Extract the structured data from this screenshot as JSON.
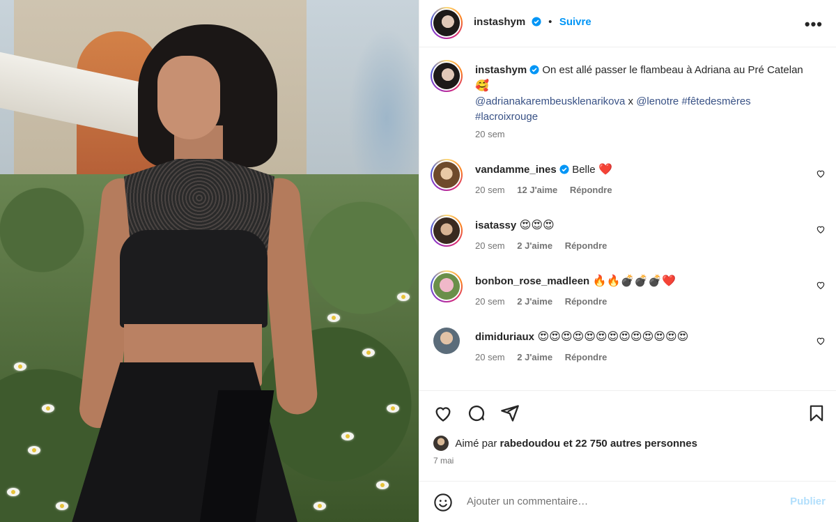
{
  "post": {
    "username": "instashym",
    "follow_label": "Suivre",
    "dot": "•",
    "more_label": "•••"
  },
  "caption": {
    "username": "instashym",
    "text": "On est allé passer le flambeau à Adriana au Pré Catelan",
    "emoji": "🥰",
    "mention1": "@adrianakarembeusklenarikova",
    "sep": "x",
    "mention2": "@lenotre",
    "tag1": "#fêtedesmères",
    "tag2": "#lacroixrouge",
    "time": "20 sem"
  },
  "comments": [
    {
      "user": "vandamme_ines",
      "verified": true,
      "text": "Belle",
      "emoji": "❤️",
      "time": "20 sem",
      "likes": "12 J'aime",
      "reply": "Répondre"
    },
    {
      "user": "isatassy",
      "verified": false,
      "text": "",
      "emoji": "😍😍😍",
      "time": "20 sem",
      "likes": "2 J'aime",
      "reply": "Répondre"
    },
    {
      "user": "bonbon_rose_madleen",
      "verified": false,
      "text": "",
      "emoji": "🔥🔥💣💣💣❤️",
      "time": "20 sem",
      "likes": "2 J'aime",
      "reply": "Répondre"
    },
    {
      "user": "dimiduriaux",
      "verified": false,
      "text": "",
      "emoji": "😍😍😍😍😍😍😍😍😍😍😍😍😍",
      "time": "20 sem",
      "likes": "2 J'aime",
      "reply": "Répondre"
    }
  ],
  "likes": {
    "prefix": "Aimé par",
    "user": "rabedoudou",
    "suffix": "et 22 750 autres personnes"
  },
  "date": "7 mai",
  "composer": {
    "placeholder": "Ajouter un commentaire…",
    "post_label": "Publier"
  },
  "colors": {
    "link": "#385185",
    "follow": "#0095f6",
    "publish_disabled": "#b2dffc",
    "heart_red": "#ed4956"
  }
}
